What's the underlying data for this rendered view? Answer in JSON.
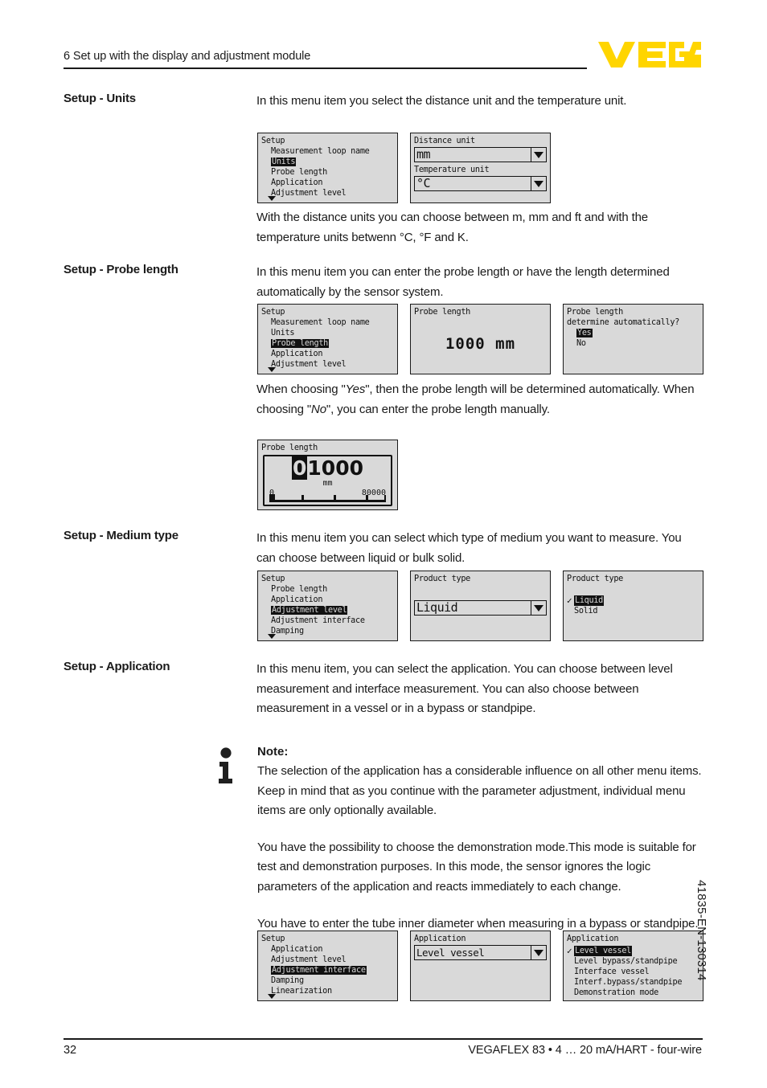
{
  "header": {
    "chapter_title": "6 Set up with the display and adjustment module",
    "logo_text": "VEGA",
    "logo_color": "#FFD500"
  },
  "sections": [
    {
      "label": "Setup - Units",
      "paragraphs": [
        "In this menu item you select the distance unit and the temperature unit."
      ],
      "after_paragraphs": [
        "With the distance units you can choose between m, mm and ft and with the temperature units betwenn °C, °F and K."
      ]
    },
    {
      "label": "Setup - Probe length",
      "paragraphs": [
        "In this menu item you can enter the probe length or have the length determined automatically by the sensor system."
      ]
    },
    {
      "label": "Setup - Medium type",
      "paragraphs": [
        "In this menu item you can select which type of medium you want to measure. You can choose between liquid or bulk solid."
      ]
    },
    {
      "label": "Setup - Application",
      "paragraphs": [
        "In this menu item, you can select the application. You can choose between level measurement and interface measurement. You can also choose between measurement in a vessel or in a bypass or standpipe."
      ]
    }
  ],
  "probe_length_explain": {
    "prefix": "When choosing \"",
    "yes": "Yes",
    "middle": "\", then the probe length will be determined automatically. When choosing \"",
    "no": "No",
    "suffix": "\", you can enter the probe length manually."
  },
  "note": {
    "title": "Note:",
    "icon": "info-icon",
    "paragraphs": [
      "The selection of the application has a considerable influence on all other menu items. Keep in mind that as you continue with the parameter adjustment, individual menu items are only optionally available.",
      "You have the possibility to choose the demonstration mode.This mode is suitable for test and demonstration purposes. In this mode, the sensor ignores the logic parameters of the application and reacts immediately to each change.",
      "You have to enter the tube inner diameter when measuring in a bypass or standpipe."
    ]
  },
  "lcd_units": {
    "menu": {
      "title": "Setup",
      "items": [
        {
          "text": "Measurement loop name",
          "highlight": false
        },
        {
          "text": "Units",
          "highlight": true
        },
        {
          "text": "Probe length",
          "highlight": false
        },
        {
          "text": "Application",
          "highlight": false
        },
        {
          "text": "Adjustment level",
          "highlight": false
        }
      ],
      "more_indicator": "scroll-down-arrow"
    },
    "fields": {
      "distance_label": "Distance unit",
      "distance_value": "mm",
      "temperature_label": "Temperature unit",
      "temperature_value": "°C"
    }
  },
  "lcd_probe": {
    "menu": {
      "title": "Setup",
      "items": [
        {
          "text": "Measurement loop name",
          "highlight": false
        },
        {
          "text": "Units",
          "highlight": false
        },
        {
          "text": "Probe length",
          "highlight": true
        },
        {
          "text": "Application",
          "highlight": false
        },
        {
          "text": "Adjustment level",
          "highlight": false
        }
      ]
    },
    "value_screen": {
      "title": "Probe length",
      "value": "1000 mm"
    },
    "auto_screen": {
      "title_line1": "Probe length",
      "title_line2": "determine automatically?",
      "options": [
        {
          "text": "Yes",
          "highlight": true
        },
        {
          "text": "No",
          "highlight": false
        }
      ]
    }
  },
  "lcd_entry": {
    "title": "Probe length",
    "cursor_digit": "0",
    "rest_digits": "1000",
    "unit": "mm",
    "scale_min": "0",
    "scale_max": "80000"
  },
  "lcd_medium": {
    "menu": {
      "title": "Setup",
      "items": [
        {
          "text": "Probe length",
          "highlight": false
        },
        {
          "text": "Application",
          "highlight": false
        },
        {
          "text": "Adjustment level",
          "highlight": true
        },
        {
          "text": "Adjustment interface",
          "highlight": false
        },
        {
          "text": "Damping",
          "highlight": false
        }
      ]
    },
    "combo": {
      "title": "Product type",
      "value": "Liquid"
    },
    "list": {
      "title": "Product type",
      "options": [
        {
          "text": "Liquid",
          "highlight": true,
          "checked": true
        },
        {
          "text": "Solid",
          "highlight": false,
          "checked": false
        }
      ]
    }
  },
  "lcd_application": {
    "menu": {
      "title": "Setup",
      "items": [
        {
          "text": "Application",
          "highlight": false
        },
        {
          "text": "Adjustment level",
          "highlight": false
        },
        {
          "text": "Adjustment interface",
          "highlight": true
        },
        {
          "text": "Damping",
          "highlight": false
        },
        {
          "text": "Linearization",
          "highlight": false
        }
      ]
    },
    "combo": {
      "title": "Application",
      "value": "Level vessel"
    },
    "list": {
      "title": "Application",
      "options": [
        {
          "text": "Level vessel",
          "highlight": true,
          "checked": true
        },
        {
          "text": "Level bypass/standpipe",
          "highlight": false,
          "checked": false
        },
        {
          "text": "Interface vessel",
          "highlight": false,
          "checked": false
        },
        {
          "text": "Interf.bypass/standpipe",
          "highlight": false,
          "checked": false
        },
        {
          "text": "Demonstration mode",
          "highlight": false,
          "checked": false
        }
      ]
    }
  },
  "side_code": "41835-EN-130314",
  "footer": {
    "page_number": "32",
    "product_line": "VEGAFLEX 83 • 4 … 20 mA/HART - four-wire"
  }
}
